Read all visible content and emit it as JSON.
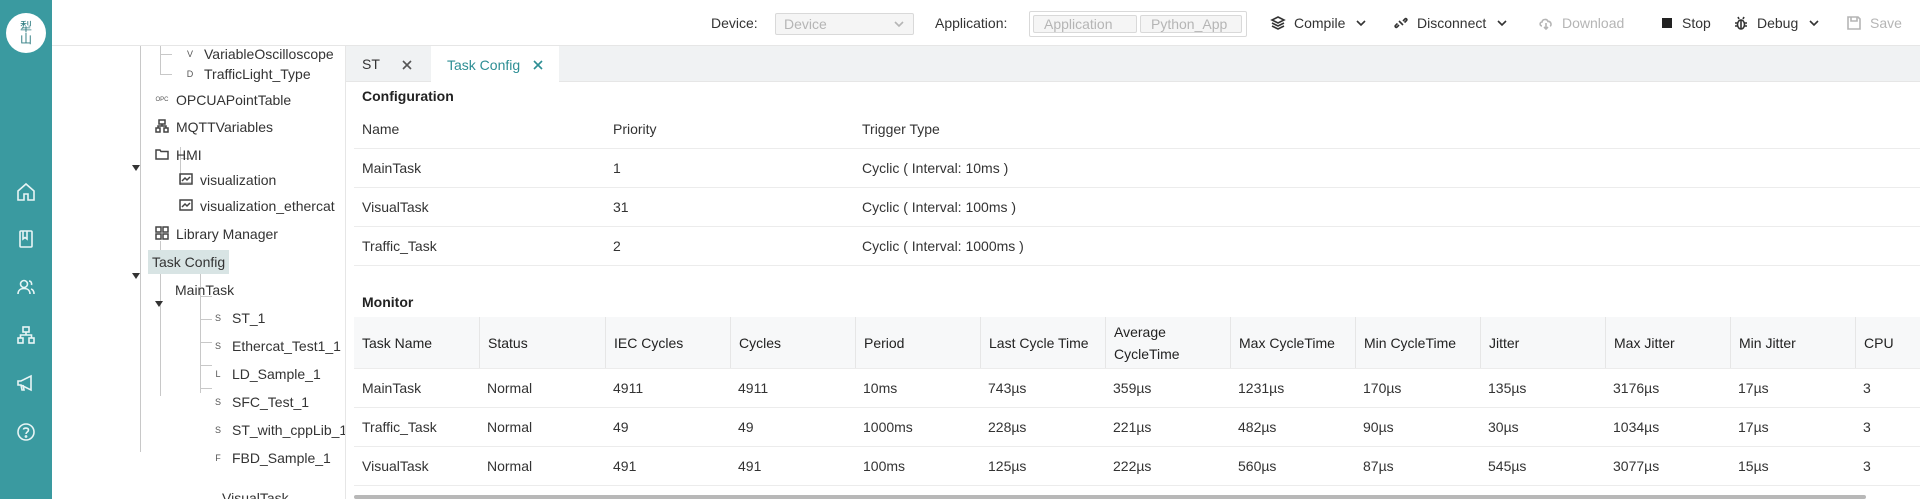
{
  "rail": {
    "logo_top": "犁",
    "logo_bottom": "山",
    "icons": [
      "home-icon",
      "book-icon",
      "users-icon",
      "network-icon",
      "megaphone-icon",
      "help-icon"
    ]
  },
  "toolbar": {
    "device_label": "Device:",
    "device_value": "Device",
    "application_label": "Application:",
    "application_value": "Application",
    "application_sub": "Python_App",
    "compile": "Compile",
    "disconnect": "Disconnect",
    "download": "Download",
    "stop": "Stop",
    "debug": "Debug",
    "save": "Save"
  },
  "tree": {
    "items": [
      {
        "label": "VariableOscilloscope",
        "icon": "V"
      },
      {
        "label": "TrafficLight_Type",
        "icon": "D"
      },
      {
        "label": "OPCUAPointTable",
        "icon": "OPC"
      },
      {
        "label": "MQTTVariables",
        "icon": "mqtt"
      },
      {
        "label": "HMI",
        "icon": "folder"
      },
      {
        "label": "visualization",
        "icon": "visual"
      },
      {
        "label": "visualization_ethercat",
        "icon": "visual"
      },
      {
        "label": "Library Manager",
        "icon": "grid"
      },
      {
        "label": "Task Config",
        "icon": ""
      },
      {
        "label": "MainTask",
        "icon": ""
      },
      {
        "label": "ST_1",
        "icon": "S"
      },
      {
        "label": "Ethercat_Test1_1",
        "icon": "S"
      },
      {
        "label": "LD_Sample_1",
        "icon": "L"
      },
      {
        "label": "SFC_Test_1",
        "icon": "S"
      },
      {
        "label": "ST_with_cppLib_1",
        "icon": "S"
      },
      {
        "label": "FBD_Sample_1",
        "icon": "F"
      },
      {
        "label": "VisualTask",
        "icon": ""
      }
    ]
  },
  "tabs": [
    {
      "label": "ST"
    },
    {
      "label": "Task Config"
    }
  ],
  "config": {
    "title": "Configuration",
    "headers": [
      "Name",
      "Priority",
      "Trigger Type"
    ],
    "rows": [
      [
        "MainTask",
        "1",
        "Cyclic ( Interval: 10ms )"
      ],
      [
        "VisualTask",
        "31",
        "Cyclic ( Interval: 100ms )"
      ],
      [
        "Traffic_Task",
        "2",
        "Cyclic ( Interval: 1000ms )"
      ]
    ]
  },
  "monitor": {
    "title": "Monitor",
    "headers": [
      "Task Name",
      "Status",
      "IEC Cycles",
      "Cycles",
      "Period",
      "Last Cycle Time",
      "Average CycleTime",
      "Max CycleTime",
      "Min CycleTime",
      "Jitter",
      "Max Jitter",
      "Min Jitter",
      "CPU"
    ],
    "rows": [
      [
        "MainTask",
        "Normal",
        "4911",
        "4911",
        "10ms",
        "743µs",
        "359µs",
        "1231µs",
        "170µs",
        "135µs",
        "3176µs",
        "17µs",
        "3"
      ],
      [
        "Traffic_Task",
        "Normal",
        "49",
        "49",
        "1000ms",
        "228µs",
        "221µs",
        "482µs",
        "90µs",
        "30µs",
        "1034µs",
        "17µs",
        "3"
      ],
      [
        "VisualTask",
        "Normal",
        "491",
        "491",
        "100ms",
        "125µs",
        "222µs",
        "560µs",
        "87µs",
        "545µs",
        "3077µs",
        "15µs",
        "3"
      ]
    ]
  },
  "colors": {
    "rail": "#3a9aa0",
    "accent": "#2d8e94",
    "selected": "#d8e4e4"
  }
}
